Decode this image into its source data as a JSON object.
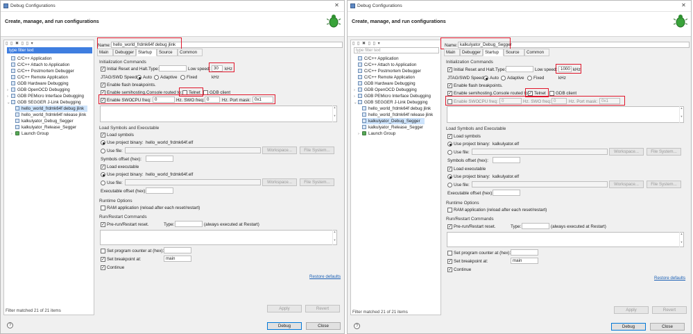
{
  "colors": {
    "highlight": "#e0162b",
    "selection": "#cde3fb",
    "filter_selected": "#3f7ee0",
    "link": "#1a5fb4"
  },
  "left": {
    "window_title": "Debug Configurations",
    "header": "Create, manage, and run configurations",
    "sidebar_toolbar": "▯ ▯ ✖ ▯ ▯ ▾",
    "filter_text": "type filter text",
    "tree": [
      "C/C++ Application",
      "C/C++ Attach to Application",
      "C/C++ Postmortem Debugger",
      "C/C++ Remote Application",
      "GDB Hardware Debugging",
      "GDB OpenOCD Debugging",
      "GDB PEMicro Interface Debugging",
      "GDB SEGGER J-Link Debugging",
      "hello_world_frdmk64f debug jlink",
      "hello_world_frdmk64f release jlink",
      "kalkulyator_Debug_Segger",
      "kalkulyator_Release_Segger",
      "Launch Group"
    ],
    "filter_status": "Filter matched 21 of 21 items",
    "name_label": "Name:",
    "name_value": "hello_world_frdmk64f debug jlink",
    "tabs": [
      "Main",
      "Debugger",
      "Startup",
      "Source",
      "Common"
    ],
    "init_cmds": "Initialization Commands",
    "initial_reset": "Initial Reset and Halt.",
    "type_label": "Type:",
    "type_value": "",
    "low_speed_label": "Low speed:",
    "low_speed_value": "30",
    "khz": "kHz",
    "jtag_speed": "JTAG/SWD Speed:",
    "auto": "Auto",
    "adaptive": "Adaptive",
    "fixed": "Fixed",
    "khz2": "kHz",
    "flash_bp": "Enable flash breakpoints.",
    "semihosting": "Enable semihosting.",
    "console_routed": "Console routed to:",
    "telnet": "Telnet",
    "gdb_client": "GDB client",
    "swo": "Enable SWO.",
    "cpu_freq": "CPU freq:",
    "cpu_freq_value": "0",
    "hz_swo": "Hz. SWO freq:",
    "swo_freq_value": "0",
    "hz_port": "Hz. Port mask:",
    "port_mask_value": "0x1",
    "load_symbols_exec": "Load Symbols and Executable",
    "load_symbols": "Load symbols",
    "use_project_binary": "Use project binary:",
    "binary_value": "hello_world_frdmk64f.elf",
    "use_file": "Use file:",
    "workspace": "Workspace...",
    "file_system": "File System...",
    "symbols_offset": "Symbols offset (hex):",
    "load_executable": "Load executable",
    "use_project_binary2": "Use project binary:",
    "binary_value2": "hello_world_frdmk64f.elf",
    "use_file2": "Use file:",
    "workspace2": "Workspace...",
    "file_system2": "File System...",
    "exec_offset": "Executable offset (hex):",
    "runtime_options": "Runtime Options",
    "ram_app": "RAM application (reload after each reset/restart)",
    "run_restart": "Run/Restart Commands",
    "pre_run": "Pre-run/Restart reset.",
    "type2": "Type:",
    "always_exec": "(always executed at Restart)",
    "set_pc": "Set program counter at (hex):",
    "set_bp": "Set breakpoint at:",
    "bp_value": "main",
    "continue": "Continue",
    "restore": "Restore defaults",
    "apply": "Apply",
    "revert": "Revert",
    "debug": "Debug",
    "close": "Close",
    "help": "?"
  },
  "right": {
    "window_title": "Debug Configurations",
    "header": "Create, manage, and run configurations",
    "sidebar_toolbar": "▯ ▯ ✖ ▯ ▯ ▾",
    "filter_text": "type filter text",
    "tree": [
      "C/C++ Application",
      "C/C++ Attach to Application",
      "C/C++ Postmortem Debugger",
      "C/C++ Remote Application",
      "GDB Hardware Debugging",
      "GDB OpenOCD Debugging",
      "GDB PEMicro Interface Debugging",
      "GDB SEGGER J-Link Debugging",
      "hello_world_frdmk64f debug jlink",
      "hello_world_frdmk64f release jlink",
      "kalkulyator_Debug_Segger",
      "kalkulyator_Release_Segger",
      "Launch Group"
    ],
    "filter_status": "Filter matched 21 of 21 items",
    "name_label": "Name:",
    "name_value": "kalkulyator_Debug_Segger",
    "tabs": [
      "Main",
      "Debugger",
      "Startup",
      "Source",
      "Common"
    ],
    "init_cmds": "Initialization Commands",
    "initial_reset": "Initial Reset and Halt.",
    "type_label": "Type:",
    "type_value": "",
    "low_speed_label": "Low speed:",
    "low_speed_value": "1000",
    "khz": "kHz",
    "jtag_speed": "JTAG/SWD Speed:",
    "auto": "Auto",
    "adaptive": "Adaptive",
    "fixed": "Fixed",
    "khz2": "kHz",
    "flash_bp": "Enable flash breakpoints.",
    "semihosting": "Enable semihosting.",
    "console_routed": "Console routed to:",
    "telnet": "Telnet",
    "gdb_client": "GDB client",
    "swo": "Enable SWO.",
    "cpu_freq": "CPU freq:",
    "cpu_freq_value": "0",
    "hz_swo": "Hz. SWO freq:",
    "swo_freq_value": "0",
    "hz_port": "Hz. Port mask:",
    "port_mask_value": "0x1",
    "load_symbols_exec": "Load Symbols and Executable",
    "load_symbols": "Load symbols",
    "use_project_binary": "Use project binary:",
    "binary_value": "kalkulyator.elf",
    "use_file": "Use file:",
    "workspace": "Workspace...",
    "file_system": "File System...",
    "symbols_offset": "Symbols offset (hex):",
    "load_executable": "Load executable",
    "use_project_binary2": "Use project binary:",
    "binary_value2": "kalkulyator.elf",
    "use_file2": "Use file:",
    "workspace2": "Workspace...",
    "file_system2": "File System...",
    "exec_offset": "Executable offset (hex):",
    "runtime_options": "Runtime Options",
    "ram_app": "RAM application (reload after each reset/restart)",
    "run_restart": "Run/Restart Commands",
    "pre_run": "Pre-run/Restart reset.",
    "type2": "Type:",
    "always_exec": "(always executed at Restart)",
    "set_pc": "Set program counter at (hex):",
    "set_bp": "Set breakpoint at:",
    "bp_value": "main",
    "continue": "Continue",
    "restore": "Restore defaults",
    "apply": "Apply",
    "revert": "Revert",
    "debug": "Debug",
    "close": "Close",
    "help": "?"
  }
}
